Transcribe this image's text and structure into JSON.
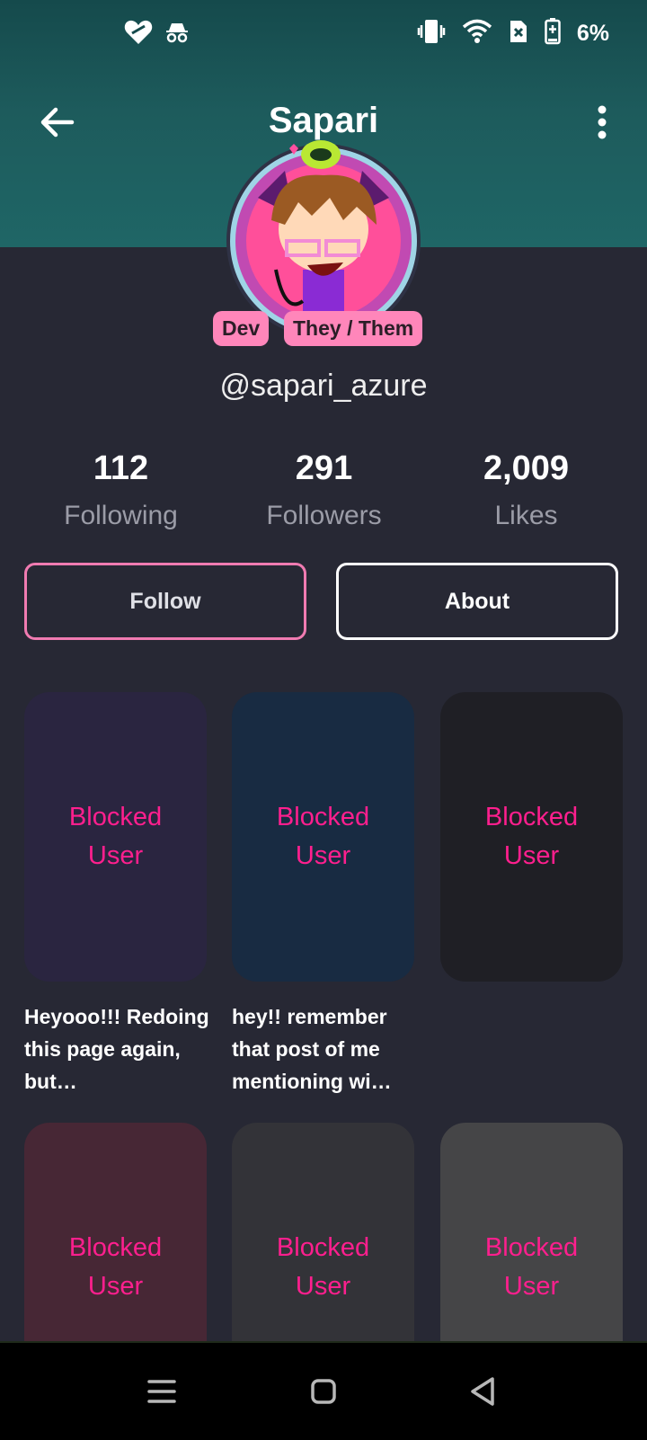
{
  "status_bar": {
    "battery_percent": "6%"
  },
  "profile": {
    "title": "Sapari",
    "handle": "@sapari_azure",
    "badges": [
      "Dev",
      "They / Them"
    ]
  },
  "stats": [
    {
      "value": "112",
      "label": "Following"
    },
    {
      "value": "291",
      "label": "Followers"
    },
    {
      "value": "2,009",
      "label": "Likes"
    }
  ],
  "actions": {
    "follow_label": "Follow",
    "about_label": "About"
  },
  "posts": [
    {
      "line1": "Blocked",
      "line2": "User",
      "caption": "Heyooo!!! Redoing this page again, but…",
      "color": "#2a2540"
    },
    {
      "line1": "Blocked",
      "line2": "User",
      "caption": "hey!! remember that post of me mentioning wi…",
      "color": "#182b42"
    },
    {
      "line1": "Blocked",
      "line2": "User",
      "caption": "",
      "color": "#1f1f25"
    },
    {
      "line1": "Blocked",
      "line2": "User",
      "caption": "",
      "color": "#472735"
    },
    {
      "line1": "Blocked",
      "line2": "User",
      "caption": "",
      "color": "#333338"
    },
    {
      "line1": "Blocked",
      "line2": "User",
      "caption": "",
      "color": "#454547"
    }
  ],
  "colors": {
    "accent_pink": "#ff1f8e",
    "follow_border": "#f07bb1",
    "header_teal": "#1d5b5c",
    "background": "#272834"
  },
  "icons": {
    "status_left": [
      "heart-icon",
      "incognito-icon"
    ],
    "status_right": [
      "vibrate-icon",
      "wifi-icon",
      "no-sim-icon",
      "battery-icon"
    ],
    "nav": [
      "recents-icon",
      "home-icon",
      "back-nav-icon"
    ]
  }
}
